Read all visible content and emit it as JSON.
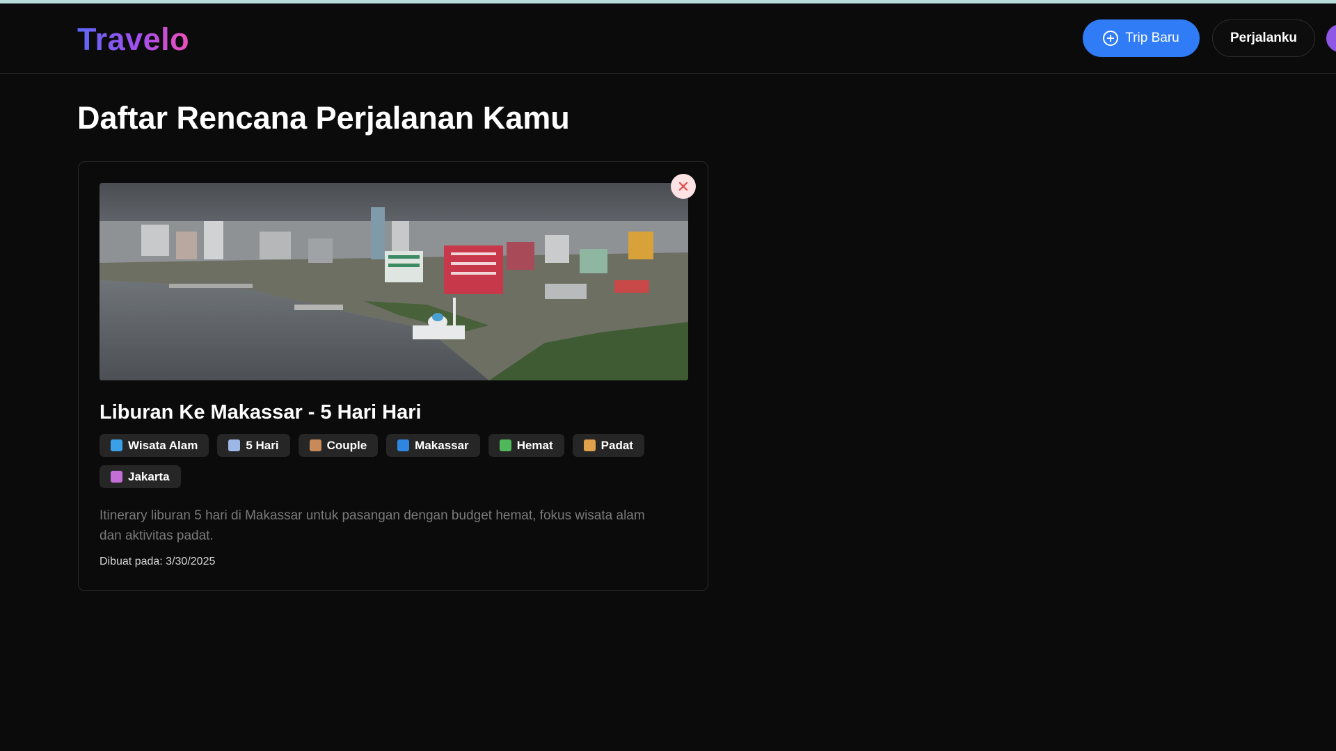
{
  "header": {
    "logo": "Travelo",
    "new_trip_label": "Trip Baru",
    "my_trips_label": "Perjalanku"
  },
  "page_title": "Daftar Rencana Perjalanan Kamu",
  "trips": [
    {
      "title": "Liburan Ke Makassar - 5 Hari Hari",
      "tags": [
        {
          "label": "Wisata Alam",
          "icon": "landscape-icon",
          "color": "#3aa0e8"
        },
        {
          "label": "5 Hari",
          "icon": "calendar-icon",
          "color": "#9bb8e6"
        },
        {
          "label": "Couple",
          "icon": "couple-icon",
          "color": "#c98a5a"
        },
        {
          "label": "Makassar",
          "icon": "wave-icon",
          "color": "#2f86e0"
        },
        {
          "label": "Hemat",
          "icon": "money-wings-icon",
          "color": "#4fb85a"
        },
        {
          "label": "Padat",
          "icon": "running-icon",
          "color": "#e0a14a"
        },
        {
          "label": "Jakarta",
          "icon": "cityscape-icon",
          "color": "#c46fd6"
        }
      ],
      "description": "Itinerary liburan 5 hari di Makassar untuk pasangan dengan budget hemat, fokus wisata alam dan aktivitas padat.",
      "created": "Dibuat pada: 3/30/2025"
    }
  ],
  "colors": {
    "background": "#0b0b0b",
    "primary_button": "#2f7cf6",
    "tag_bg": "#262626",
    "delete_icon": "#e34848"
  }
}
